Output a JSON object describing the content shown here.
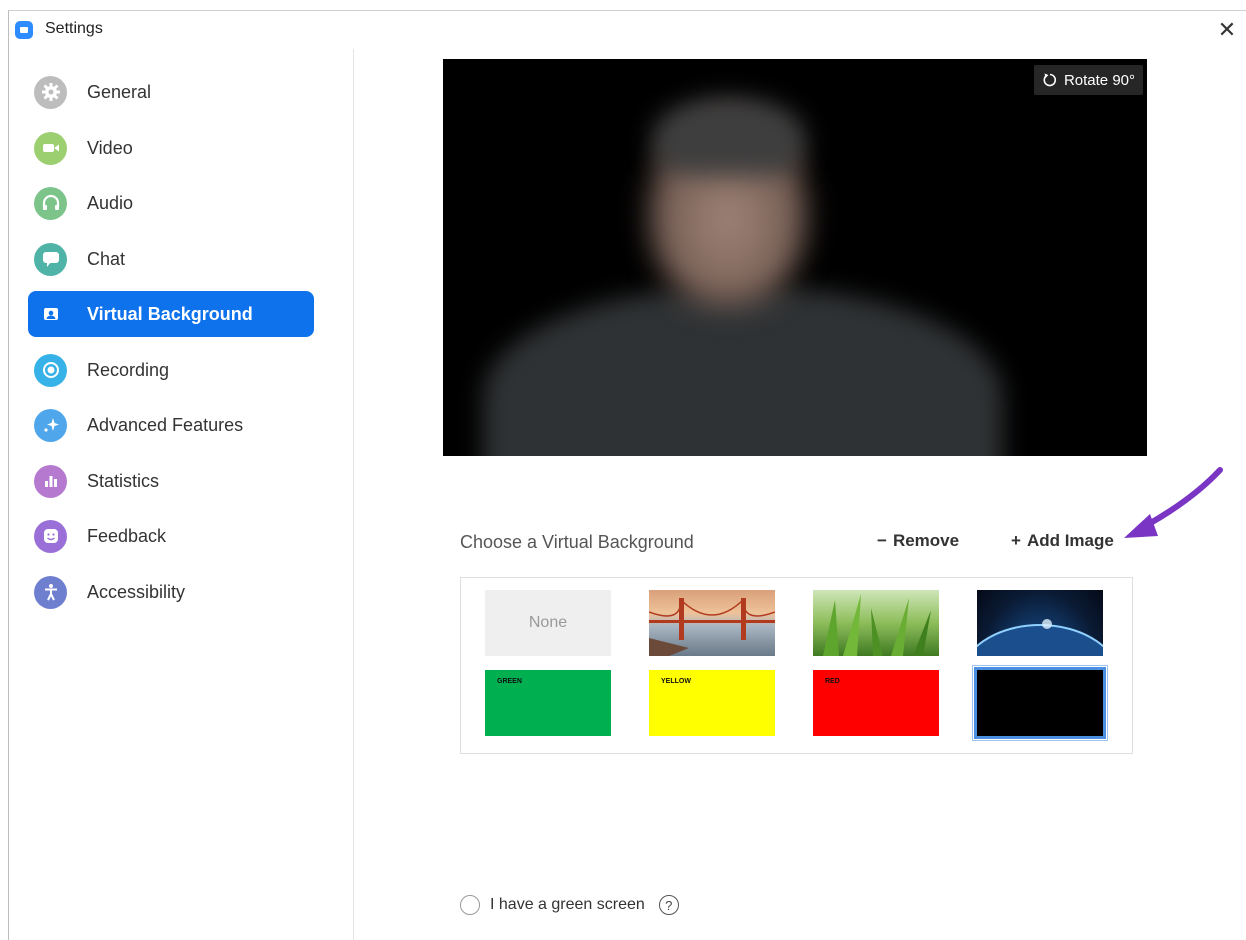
{
  "window": {
    "title": "Settings",
    "close_glyph": "✕"
  },
  "sidebar": {
    "items": [
      {
        "label": "General",
        "icon": "gear-icon",
        "color": "#bdbdbd"
      },
      {
        "label": "Video",
        "icon": "video-camera-icon",
        "color": "#9ccf70"
      },
      {
        "label": "Audio",
        "icon": "headphones-icon",
        "color": "#7cc48a"
      },
      {
        "label": "Chat",
        "icon": "chat-bubble-icon",
        "color": "#4fb3a8"
      },
      {
        "label": "Virtual Background",
        "icon": "portrait-icon",
        "color": "#0e72ed",
        "active": true
      },
      {
        "label": "Recording",
        "icon": "record-icon",
        "color": "#36b2e8"
      },
      {
        "label": "Advanced Features",
        "icon": "sparkle-icon",
        "color": "#4fa6ea"
      },
      {
        "label": "Statistics",
        "icon": "bar-chart-icon",
        "color": "#b57ad0"
      },
      {
        "label": "Feedback",
        "icon": "smiley-icon",
        "color": "#9a6fd8"
      },
      {
        "label": "Accessibility",
        "icon": "accessibility-icon",
        "color": "#6f7fd0"
      }
    ]
  },
  "preview": {
    "rotate_label": "Rotate 90°"
  },
  "backgrounds": {
    "title": "Choose a Virtual Background",
    "remove_label": "Remove",
    "add_label": "Add Image",
    "items": [
      {
        "label": "None",
        "kind": "none"
      },
      {
        "label": "",
        "kind": "bridge"
      },
      {
        "label": "",
        "kind": "grass"
      },
      {
        "label": "",
        "kind": "earth"
      },
      {
        "label": "GREEN",
        "kind": "solid",
        "color": "#00b050"
      },
      {
        "label": "YELLOW",
        "kind": "solid",
        "color": "#ffff00"
      },
      {
        "label": "RED",
        "kind": "solid",
        "color": "#ff0000"
      },
      {
        "label": "",
        "kind": "solid",
        "color": "#000000",
        "selected": true
      }
    ]
  },
  "green_screen": {
    "label": "I have a green screen",
    "help_glyph": "?"
  },
  "annotation": {
    "arrow_color": "#7a35c4"
  }
}
